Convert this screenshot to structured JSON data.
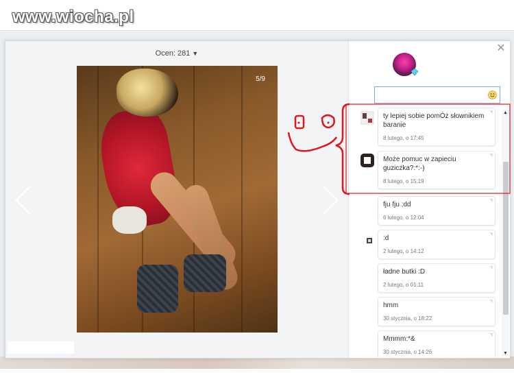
{
  "site": {
    "logo_text": "www.wiocha.pl"
  },
  "viewer": {
    "rating_label": "Ocen: 281",
    "rating_caret": "▼",
    "photo_counter": "5/9",
    "prev_icon": "chevron-left-icon",
    "next_icon": "chevron-right-icon"
  },
  "sidebar": {
    "close_icon": "close-icon",
    "comment_input_value": "",
    "comments": [
      {
        "text": "ty lepiej sobie pomÓż słownikiem baranie",
        "time": "8 lutego, o 17:45"
      },
      {
        "text": "Może pomuc w zapieciu guziczka?:*:-)",
        "time": "8 lutego, o 15:19"
      },
      {
        "text": "fju fju ;dd",
        "time": "6 lutego, o 12:04"
      },
      {
        "text": ":d",
        "time": "2 lutego, o 14:12"
      },
      {
        "text": "ładne butki :D",
        "time": "2 lutego, o 01:11"
      },
      {
        "text": "hmm",
        "time": "30 stycznia, o 18:22"
      },
      {
        "text": "Mmmm:*&",
        "time": "30 stycznia, o 14:26"
      }
    ]
  },
  "colors": {
    "annotation": "#e0161b",
    "input_border": "#7aa8d8",
    "accent_pink": "#c41e8a"
  }
}
